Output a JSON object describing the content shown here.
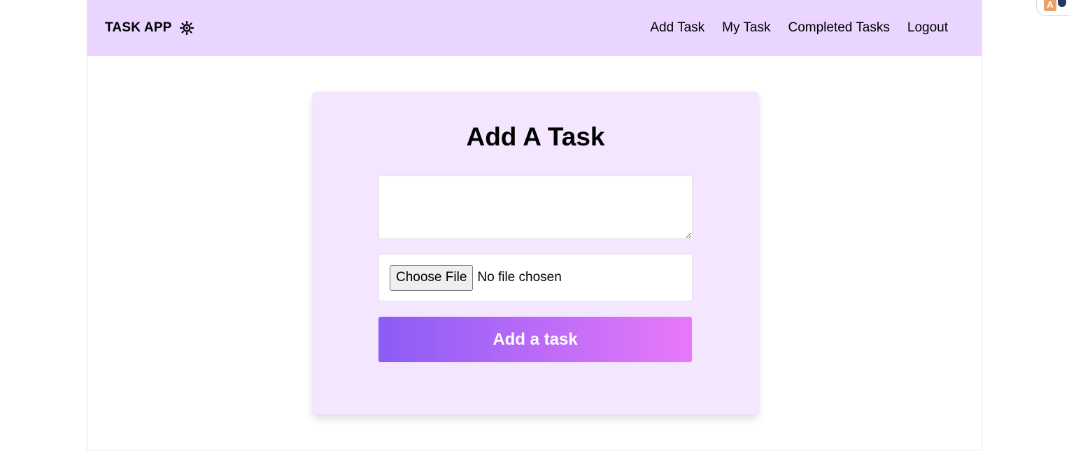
{
  "header": {
    "brand": "TASK APP",
    "theme_toggle_icon": "sun-icon",
    "nav": [
      {
        "label": "Add Task"
      },
      {
        "label": "My Task"
      },
      {
        "label": "Completed Tasks"
      },
      {
        "label": "Logout"
      }
    ]
  },
  "form": {
    "title": "Add A Task",
    "task_input": {
      "value": "",
      "placeholder": ""
    },
    "file_input": {
      "button_label": "Choose File",
      "status": "No file chosen"
    },
    "submit_label": "Add a task"
  },
  "extension_badge": {
    "icon": "translate-icon",
    "letter": "A"
  },
  "colors": {
    "navbar_bg": "#e9d5ff",
    "card_bg": "#f3e6fe",
    "button_gradient_start": "#8b5cf6",
    "button_gradient_end": "#e879f9"
  }
}
